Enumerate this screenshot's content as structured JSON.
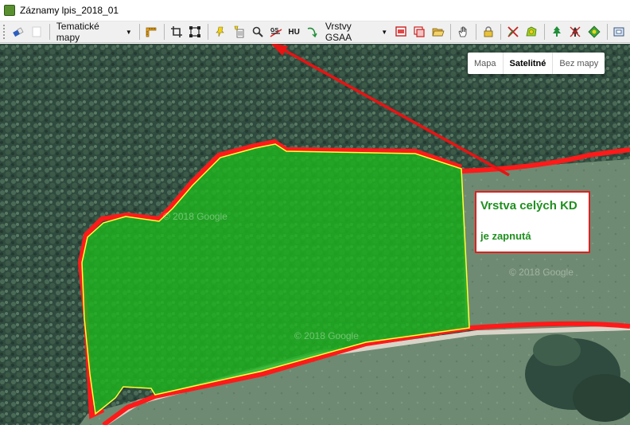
{
  "window": {
    "title": "Záznamy lpis_2018_01"
  },
  "toolbar": {
    "thematic_maps_label": "Tematické mapy",
    "hu_label": "HU",
    "gs_label": "GS",
    "gsaa_layers_label": "Vrstvy GSAA"
  },
  "map": {
    "maptype": {
      "options": [
        "Mapa",
        "Satelitné",
        "Bez mapy"
      ],
      "selected": "Satelitné"
    },
    "watermarks": [
      "© 2018 Google",
      "© 2018 Google",
      "© 2018 Google"
    ],
    "annotation": {
      "line1": "Vrstva celých KD",
      "line2": "je zapnutá"
    }
  },
  "colors": {
    "parcel_fill": "#1fb51f",
    "parcel_border": "#ffff33",
    "block_border": "#ff1a1a",
    "arrow": "#e81313"
  }
}
